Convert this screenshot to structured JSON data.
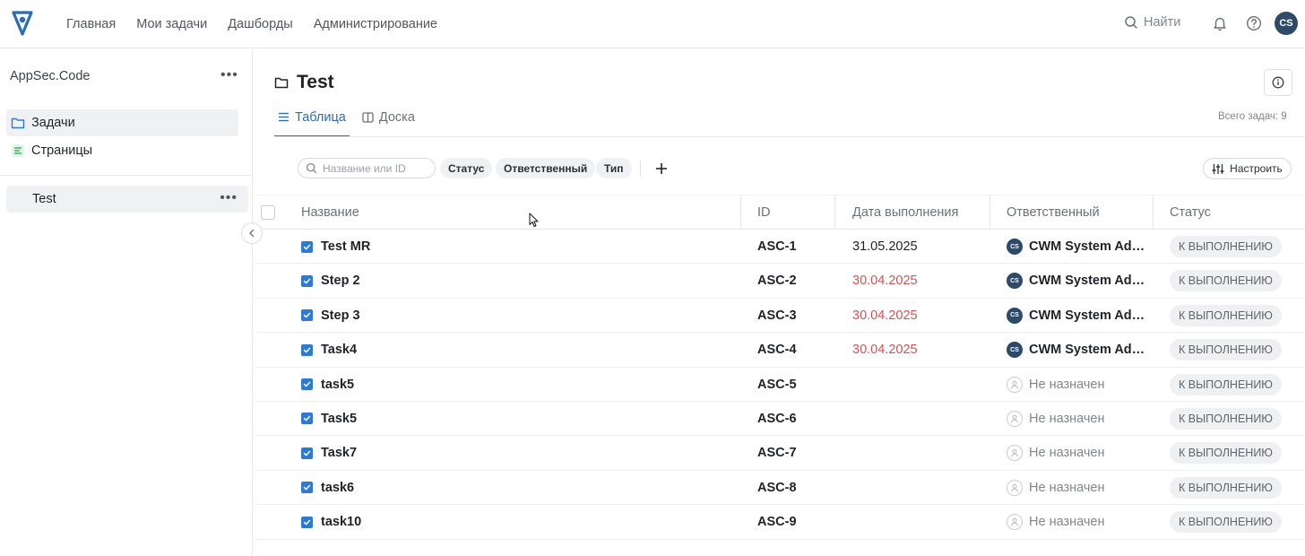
{
  "nav": {
    "items": [
      "Главная",
      "Мои задачи",
      "Дашборды",
      "Администрирование"
    ],
    "search_label": "Найти",
    "user_initials": "CS"
  },
  "sidebar": {
    "project": "AppSec.Code",
    "items": [
      {
        "label": "Задачи",
        "icon": "folder-icon",
        "active": true
      },
      {
        "label": "Страницы",
        "icon": "pages-icon",
        "active": false
      }
    ],
    "section": "Test"
  },
  "main": {
    "title": "Test",
    "tabs": [
      {
        "label": "Таблица",
        "icon": "list-icon",
        "active": true
      },
      {
        "label": "Доска",
        "icon": "board-icon",
        "active": false
      }
    ],
    "total": "Всего задач: 9"
  },
  "filters": {
    "search_placeholder": "Название или ID",
    "chips": [
      "Статус",
      "Ответственный",
      "Тип"
    ],
    "configure_label": "Настроить"
  },
  "table": {
    "columns": [
      "Название",
      "ID",
      "Дата выполнения",
      "Ответственный",
      "Статус"
    ],
    "rows": [
      {
        "name": "Test MR",
        "id": "ASC-1",
        "date": "31.05.2025",
        "overdue": false,
        "assignee": "CWM System Admi...",
        "assignee_initials": "CS",
        "assigned": true,
        "status": "К ВЫПОЛНЕНИЮ"
      },
      {
        "name": "Step 2",
        "id": "ASC-2",
        "date": "30.04.2025",
        "overdue": true,
        "assignee": "CWM System Admi...",
        "assignee_initials": "CS",
        "assigned": true,
        "status": "К ВЫПОЛНЕНИЮ"
      },
      {
        "name": "Step 3",
        "id": "ASC-3",
        "date": "30.04.2025",
        "overdue": true,
        "assignee": "CWM System Admi...",
        "assignee_initials": "CS",
        "assigned": true,
        "status": "К ВЫПОЛНЕНИЮ"
      },
      {
        "name": "Task4",
        "id": "ASC-4",
        "date": "30.04.2025",
        "overdue": true,
        "assignee": "CWM System Admi...",
        "assignee_initials": "CS",
        "assigned": true,
        "status": "К ВЫПОЛНЕНИЮ"
      },
      {
        "name": "task5",
        "id": "ASC-5",
        "date": "",
        "overdue": false,
        "assignee": "Не назначен",
        "assignee_initials": "",
        "assigned": false,
        "status": "К ВЫПОЛНЕНИЮ"
      },
      {
        "name": "Task5",
        "id": "ASC-6",
        "date": "",
        "overdue": false,
        "assignee": "Не назначен",
        "assignee_initials": "",
        "assigned": false,
        "status": "К ВЫПОЛНЕНИЮ"
      },
      {
        "name": "Task7",
        "id": "ASC-7",
        "date": "",
        "overdue": false,
        "assignee": "Не назначен",
        "assignee_initials": "",
        "assigned": false,
        "status": "К ВЫПОЛНЕНИЮ"
      },
      {
        "name": "task6",
        "id": "ASC-8",
        "date": "",
        "overdue": false,
        "assignee": "Не назначен",
        "assignee_initials": "",
        "assigned": false,
        "status": "К ВЫПОЛНЕНИЮ"
      },
      {
        "name": "task10",
        "id": "ASC-9",
        "date": "",
        "overdue": false,
        "assignee": "Не назначен",
        "assignee_initials": "",
        "assigned": false,
        "status": "К ВЫПОЛНЕНИЮ"
      }
    ]
  },
  "colors": {
    "accent": "#2b6cb8",
    "overdue": "#d45353",
    "avatar": "#2c4a6b",
    "task_icon": "#2b7bd6"
  }
}
